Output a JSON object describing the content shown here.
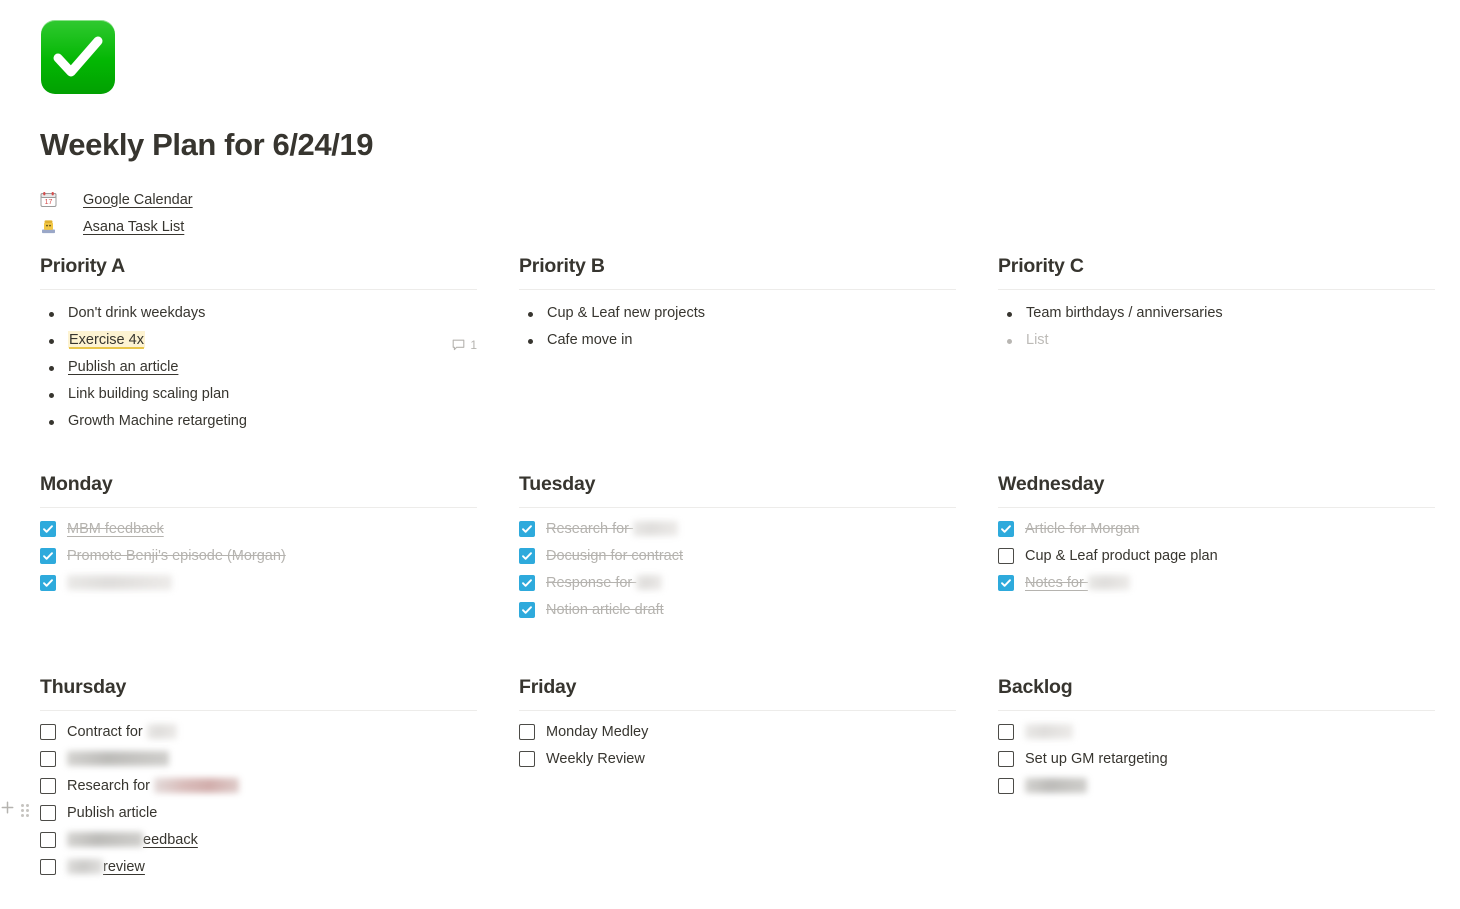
{
  "page": {
    "icon": "green-check-mark-emoji",
    "title": "Weekly Plan for 6/24/19"
  },
  "links": [
    {
      "emoji": "calendar-emoji",
      "label": "Google Calendar"
    },
    {
      "emoji": "technologist-emoji",
      "label": "Asana Task List"
    }
  ],
  "colors": {
    "checkbox_checked": "#2eaadc",
    "checkbox_border": "#4c4b47",
    "highlight_background": "#fdf3d2",
    "highlight_underline": "#e8c54a",
    "muted_text": "#b5b3af",
    "text": "#37352f",
    "rule": "#edecea",
    "icon_green": "#03b703"
  },
  "sections": {
    "priority_a": {
      "heading": "Priority A",
      "items": [
        {
          "text": "Don't drink weekdays",
          "style": "plain"
        },
        {
          "text": "Exercise 4x",
          "style": "highlight",
          "comment_count": "1"
        },
        {
          "text": "Publish an article",
          "style": "link"
        },
        {
          "text": "Link building scaling plan",
          "style": "plain"
        },
        {
          "text": "Growth Machine retargeting",
          "style": "plain"
        }
      ]
    },
    "priority_b": {
      "heading": "Priority B",
      "items": [
        {
          "text": "Cup & Leaf new projects",
          "style": "plain"
        },
        {
          "text": "Cafe move in",
          "style": "plain"
        }
      ]
    },
    "priority_c": {
      "heading": "Priority C",
      "items": [
        {
          "text": "Team birthdays / anniversaries",
          "style": "plain"
        },
        {
          "text": "List",
          "style": "placeholder"
        }
      ]
    },
    "monday": {
      "heading": "Monday",
      "items": [
        {
          "text": "MBM feedback",
          "checked": true,
          "underlined": true,
          "redacted_after": 0
        },
        {
          "text": "Promote Benji's episode (Morgan)",
          "checked": true,
          "underlined": false,
          "redacted_after": 0
        },
        {
          "text": "",
          "checked": true,
          "underlined": false,
          "redacted_after": 105,
          "redact_style": "light"
        }
      ]
    },
    "tuesday": {
      "heading": "Tuesday",
      "items": [
        {
          "text": "Research for ",
          "checked": true,
          "underlined": false,
          "redacted_after": 45,
          "redact_style": "light"
        },
        {
          "text": "Docusign for contract",
          "checked": true,
          "underlined": false,
          "redacted_after": 0
        },
        {
          "text": "Response for ",
          "checked": true,
          "underlined": false,
          "redacted_after": 26,
          "redact_style": "light"
        },
        {
          "text": "Notion article draft",
          "checked": true,
          "underlined": false,
          "redacted_after": 0
        }
      ]
    },
    "wednesday": {
      "heading": "Wednesday",
      "items": [
        {
          "text": "Article for Morgan",
          "checked": true,
          "underlined": false,
          "redacted_after": 0
        },
        {
          "text": "Cup & Leaf product page plan",
          "checked": false,
          "underlined": false,
          "redacted_after": 0
        },
        {
          "text": "Notes for ",
          "checked": true,
          "underlined": true,
          "redacted_after": 42,
          "redact_style": "light"
        }
      ]
    },
    "thursday": {
      "heading": "Thursday",
      "items": [
        {
          "text": "Contract for ",
          "checked": false,
          "underlined": false,
          "redacted_after": 30,
          "redact_style": "light"
        },
        {
          "text": "",
          "checked": false,
          "underlined": false,
          "redacted_after": 102,
          "redact_style": "dark"
        },
        {
          "text": "Research for ",
          "checked": false,
          "underlined": false,
          "redacted_after": 85,
          "redact_style": "pinkish"
        },
        {
          "text": "Publish article",
          "checked": false,
          "underlined": false,
          "redacted_after": 0
        },
        {
          "text": "eedback",
          "checked": false,
          "underlined": true,
          "redacted_before": 76,
          "redact_style": "dark"
        },
        {
          "text": "review",
          "checked": false,
          "underlined": true,
          "redacted_before": 36,
          "redact_style": "greyblue"
        }
      ]
    },
    "friday": {
      "heading": "Friday",
      "items": [
        {
          "text": "Monday Medley",
          "checked": false,
          "underlined": false,
          "redacted_after": 0
        },
        {
          "text": "Weekly Review",
          "checked": false,
          "underlined": false,
          "redacted_after": 0
        }
      ]
    },
    "backlog": {
      "heading": "Backlog",
      "items": [
        {
          "text": "",
          "checked": false,
          "underlined": false,
          "redacted_after": 48,
          "redact_style": "light"
        },
        {
          "text": "Set up GM retargeting",
          "checked": false,
          "underlined": false,
          "redacted_after": 0
        },
        {
          "text": "",
          "checked": false,
          "underlined": false,
          "redacted_after": 62,
          "redact_style": "dark"
        }
      ]
    }
  },
  "gutter": {
    "add_label": "+",
    "drag_label": "drag-handle"
  }
}
